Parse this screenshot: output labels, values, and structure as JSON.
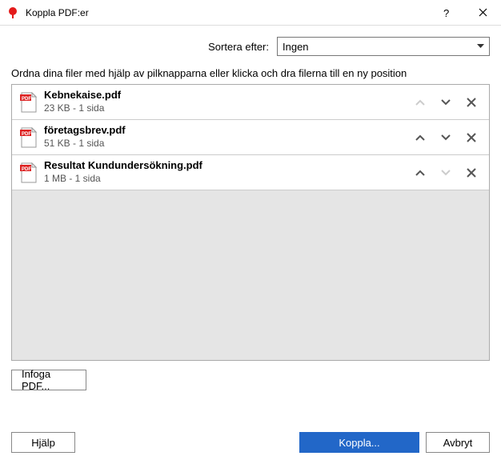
{
  "window": {
    "title": "Koppla PDF:er"
  },
  "sort": {
    "label": "Sortera efter:",
    "value": "Ingen"
  },
  "instruction": "Ordna dina filer med hjälp av pilknapparna eller klicka och dra filerna till en ny position",
  "files": [
    {
      "name": "Kebnekaise.pdf",
      "meta": "23 KB - 1 sida",
      "up_enabled": false,
      "down_enabled": true
    },
    {
      "name": "företagsbrev.pdf",
      "meta": "51 KB - 1 sida",
      "up_enabled": true,
      "down_enabled": true
    },
    {
      "name": "Resultat Kundundersökning.pdf",
      "meta": "1 MB - 1 sida",
      "up_enabled": true,
      "down_enabled": false
    }
  ],
  "buttons": {
    "insert": "Infoga PDF...",
    "help": "Hjälp",
    "merge": "Koppla...",
    "cancel": "Avbryt"
  }
}
